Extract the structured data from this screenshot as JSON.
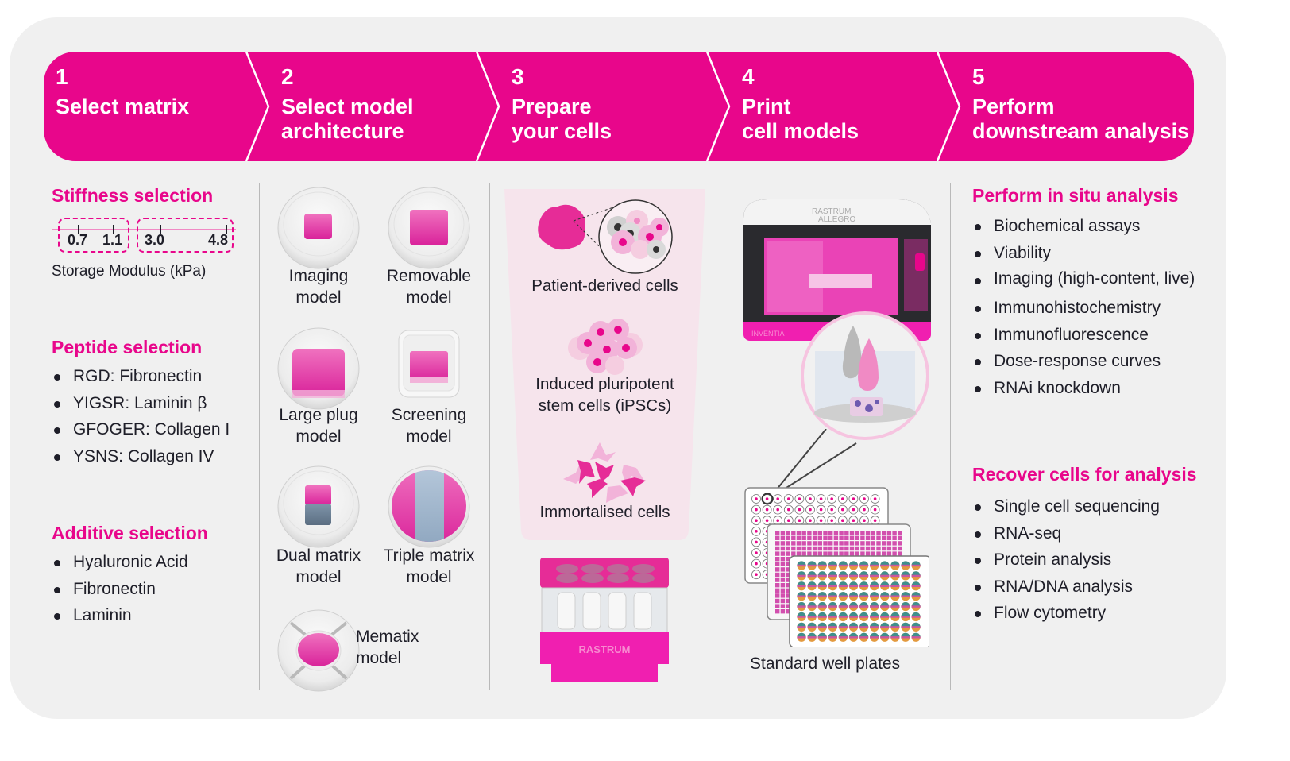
{
  "colors": {
    "brand_pink": "#e8068b",
    "panel_bg": "#f0f0f0",
    "text": "#1e1e28",
    "light_pink": "#f6e4ec",
    "grey_blue": "#a9bfd6"
  },
  "steps": [
    {
      "number": "1",
      "title_line1": "Select matrix",
      "title_line2": ""
    },
    {
      "number": "2",
      "title_line1": "Select model",
      "title_line2": "architecture"
    },
    {
      "number": "3",
      "title_line1": "Prepare",
      "title_line2": "your cells"
    },
    {
      "number": "4",
      "title_line1": "Print",
      "title_line2": "cell models"
    },
    {
      "number": "5",
      "title_line1": "Perform",
      "title_line2": "downstream analysis"
    }
  ],
  "col1": {
    "stiffness": {
      "heading": "Stiffness selection",
      "values": [
        "0.7",
        "1.1",
        "3.0",
        "4.8"
      ],
      "axis_label": "Storage Modulus (kPa)"
    },
    "peptide": {
      "heading": "Peptide selection",
      "items": [
        "RGD: Fibronectin",
        "YIGSR: Laminin β",
        "GFOGER: Collagen I",
        "YSNS: Collagen IV"
      ]
    },
    "additive": {
      "heading": "Additive selection",
      "items": [
        "Hyaluronic Acid",
        "Fibronectin",
        "Laminin"
      ]
    }
  },
  "col2": {
    "models": [
      {
        "line1": "Imaging",
        "line2": "model"
      },
      {
        "line1": "Removable",
        "line2": "model"
      },
      {
        "line1": "Large plug",
        "line2": "model"
      },
      {
        "line1": "Screening",
        "line2": "model"
      },
      {
        "line1": "Dual matrix",
        "line2": "model"
      },
      {
        "line1": "Triple matrix",
        "line2": "model"
      },
      {
        "line1": "Mematix",
        "line2": "model"
      }
    ]
  },
  "col3": {
    "cells": [
      {
        "line1": "Patient-derived cells",
        "line2": ""
      },
      {
        "line1": "Induced pluripotent",
        "line2": "stem cells (iPSCs)"
      },
      {
        "line1": "Immortalised cells",
        "line2": ""
      }
    ],
    "cartridge_brand": "RASTRUM"
  },
  "col4": {
    "printer_brand_line1": "RASTRUM",
    "printer_brand_line2": "ALLEGRO",
    "printer_maker": "INVENTIA",
    "plates_label": "Standard well plates"
  },
  "col5": {
    "in_situ": {
      "heading": "Perform in situ analysis",
      "items": [
        "Biochemical assays",
        "Viability",
        "Imaging (high-content, live)",
        "Immunohistochemistry",
        "Immunofluorescence",
        "Dose-response curves",
        "RNAi knockdown"
      ]
    },
    "recover": {
      "heading": "Recover cells for analysis",
      "items": [
        "Single cell sequencing",
        "RNA-seq",
        "Protein analysis",
        "RNA/DNA analysis",
        "Flow cytometry"
      ]
    }
  }
}
